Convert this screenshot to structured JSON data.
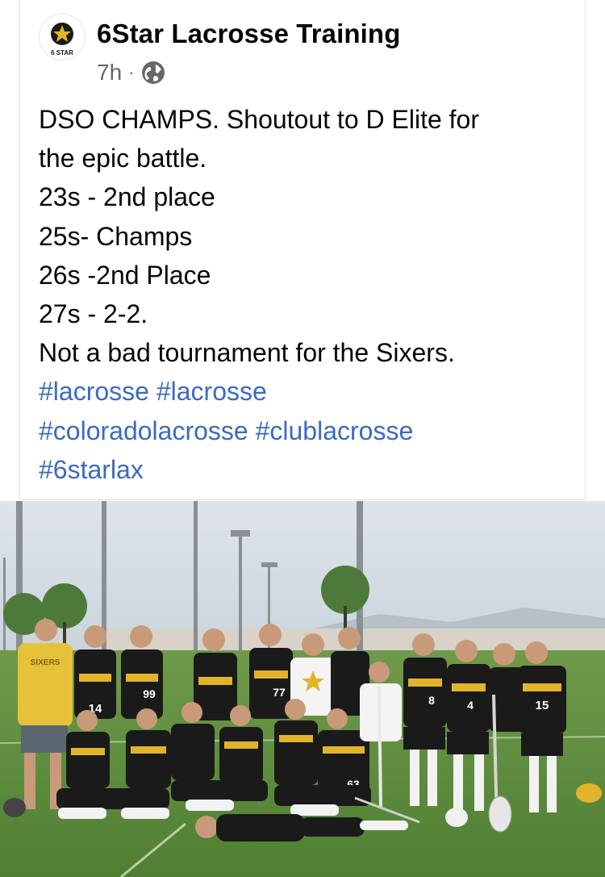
{
  "post": {
    "author": "6Star Lacrosse Training",
    "avatar_text": "6 STAR",
    "time": "7h",
    "separator": "·",
    "privacy_icon": "globe-icon",
    "lines": [
      "DSO CHAMPS.  Shoutout to D Elite for",
      "the epic battle.",
      "23s - 2nd place",
      "25s- Champs",
      "26s -2nd Place",
      "27s - 2-2.",
      "Not a bad tournament for the Sixers."
    ],
    "hashtag_lines": [
      "#lacrosse #lacrosse",
      "#coloradolacrosse #clublacrosse",
      "#6starlax"
    ]
  },
  "photo": {
    "banner_text": "SIXERS",
    "jersey_numbers": [
      "14",
      "99",
      "77",
      "8",
      "4",
      "15",
      "63"
    ]
  },
  "colors": {
    "hashtag": "#3b6ac2",
    "meta": "#65676b",
    "jersey_black": "#1a1a1a",
    "jersey_gold": "#e1b42a",
    "coach_shirt": "#e6c23a",
    "turf": "#5b8a3c"
  }
}
